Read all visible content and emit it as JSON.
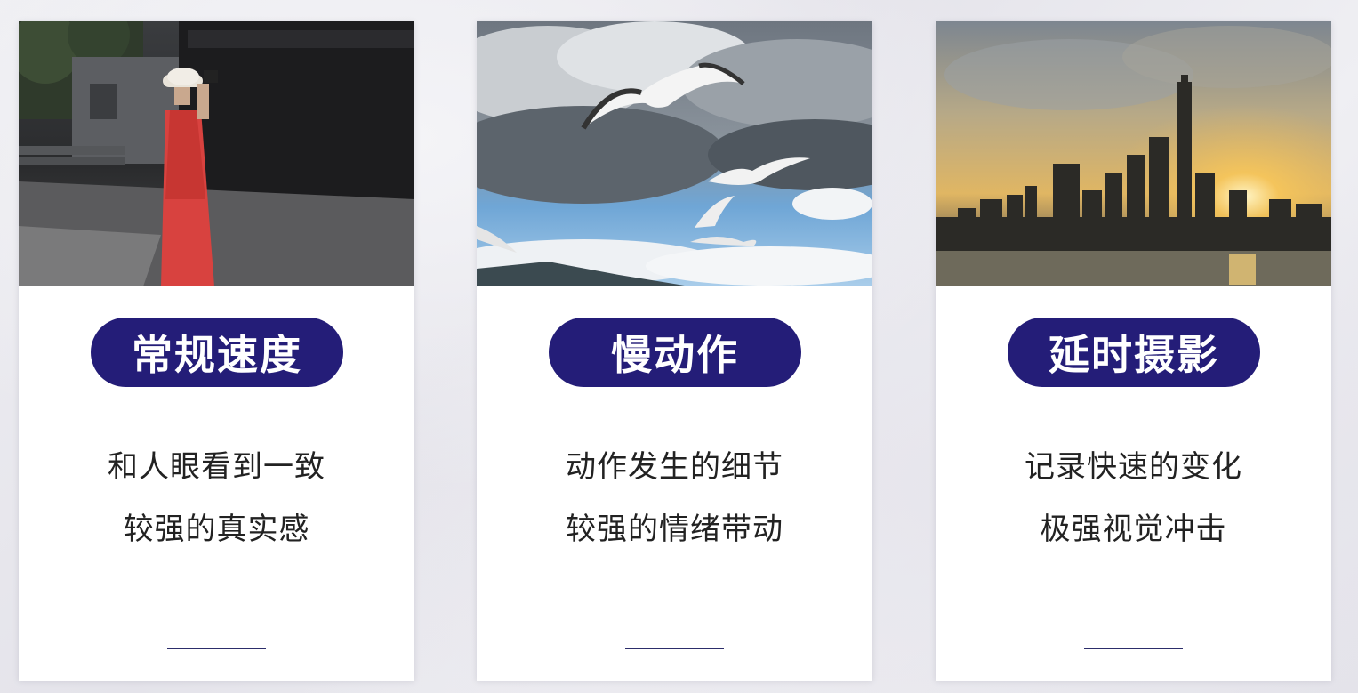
{
  "cards": [
    {
      "title": "常规速度",
      "line1": "和人眼看到一致",
      "line2": "较强的真实感",
      "photo": "woman-in-red-dress-with-camera"
    },
    {
      "title": "慢动作",
      "line1": "动作发生的细节",
      "line2": "较强的情绪带动",
      "photo": "seagulls-flying-in-cloudy-sky"
    },
    {
      "title": "延时摄影",
      "line1": "记录快速的变化",
      "line2": "极强视觉冲击",
      "photo": "city-skyline-at-sunset"
    }
  ],
  "colors": {
    "pill": "#241d78",
    "pill_text": "#ffffff",
    "body_text": "#222222",
    "underline": "#2c2d6a"
  }
}
